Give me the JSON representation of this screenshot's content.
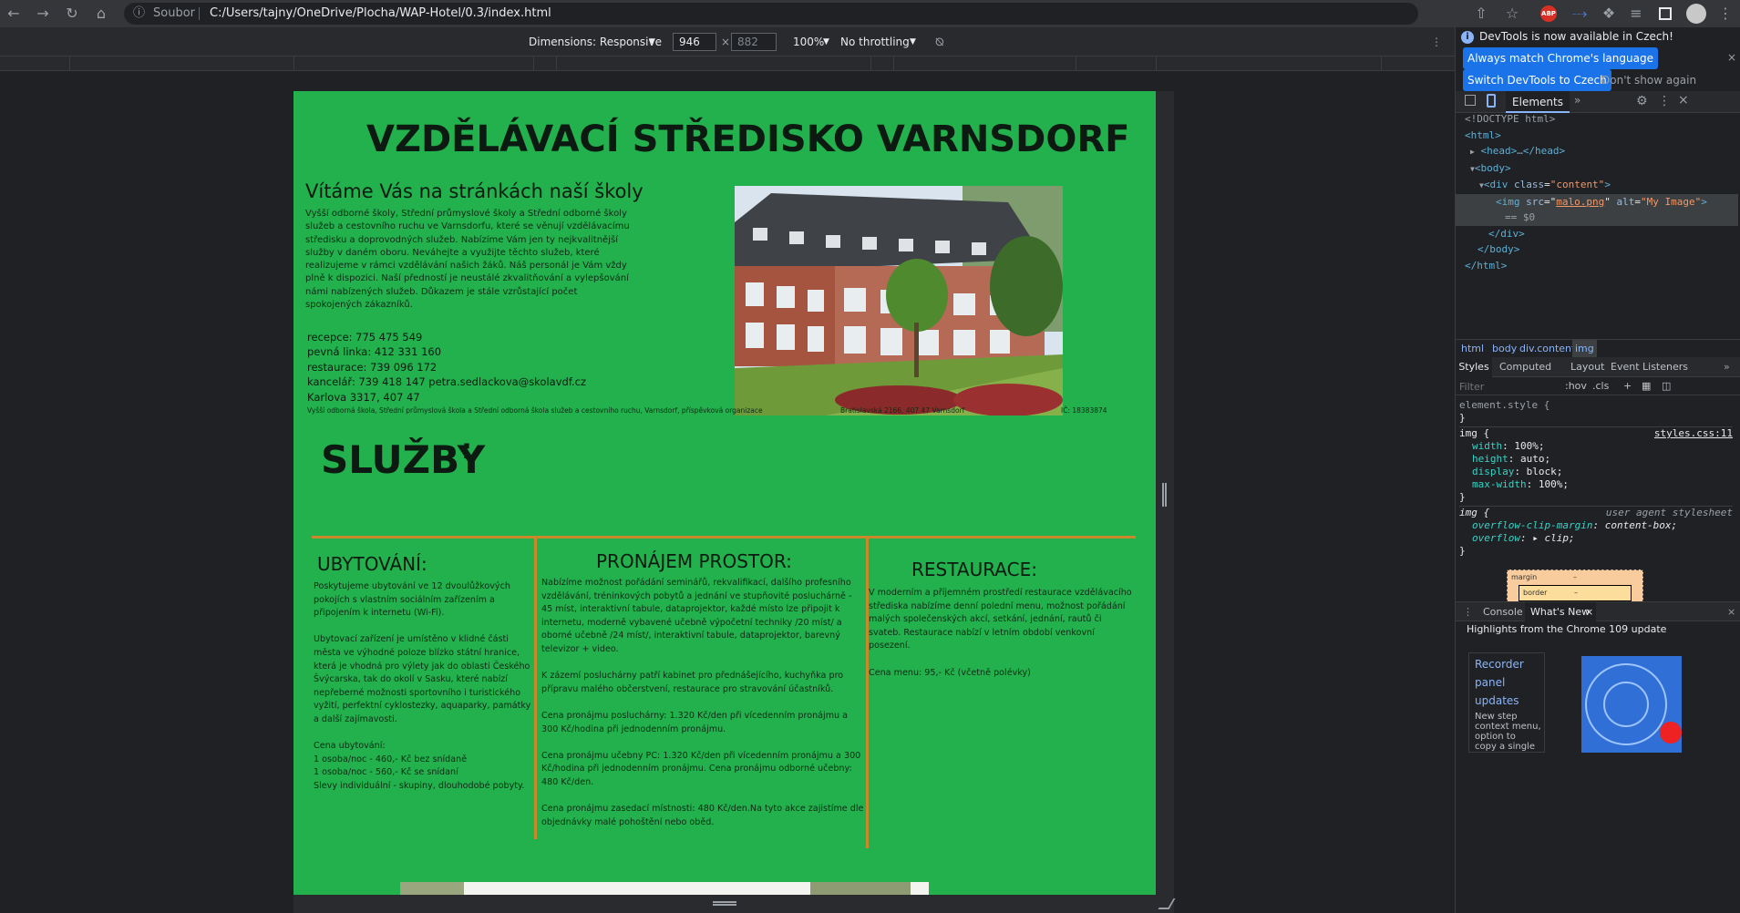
{
  "browser": {
    "url_security": "Soubor",
    "url": "C:/Users/tajny/OneDrive/Plocha/WAP-Hotel/0.3/index.html",
    "ext_abp": "ABP"
  },
  "device_toolbar": {
    "dimensions_label": "Dimensions: Responsive",
    "width": "946",
    "height": "882",
    "zoom": "100%",
    "throttling": "No throttling"
  },
  "page": {
    "title": "VZDĚLÁVACÍ STŘEDISKO VARNSDORF",
    "welcome": "Vítáme Vás na stránkách naší školy",
    "intro_lines": [
      "Vyšší odborné školy, Střední průmyslové školy a Střední odborné školy",
      "služeb a cestovního ruchu ve Varnsdorfu, které se věnují vzdělávacímu",
      "středisku a doprovodných služeb. Nabízíme Vám jen ty nejkvalitnější",
      "služby v daném oboru. Neváhejte a využijte těchto služeb, které",
      "realizujeme v rámci vzdělávání našich žáků. Náš personál je Vám vždy",
      "plně k dispozici. Naší předností je neustálé zkvalitňování a vylepšování",
      "námi nabízených služeb. Důkazem je stále vzrůstající počet",
      "spokojených zákazníků."
    ],
    "contact_lines": [
      "recepce: 775 475 549",
      "pevná linka: 412 331 160",
      "restaurace: 739 096 172",
      "kancelář: 739 418 147 petra.sedlackova@skolavdf.cz",
      "Karlova 3317, 407 47"
    ],
    "footer_org": "Vyšší odborná škola, Střední průmyslová škola a Střední odborná škola služeb a cestovního ruchu, Varnsdorf, příspěvková organizace",
    "footer_address": "Bratislavská 2166, 407 47 Varnsdorf",
    "footer_ic": "IČ: 18383874",
    "services_heading": "SLUŽBY",
    "services_colon": ":",
    "col1_title": "UBYTOVÁNÍ:",
    "col1_text": "Poskytujeme ubytování ve 12 dvoulůžkových\npokojích s vlastním sociálním zařízením a\npřipojením k internetu (Wi-Fi).\n\nUbytovací zařízení je umístěno v klidné části\nměsta ve výhodné poloze blízko státní hranice,\nkterá je vhodná pro výlety jak do oblasti Českého\nŠvýcarska, tak do okolí v Sasku, které nabízí\nnepřeberné možnosti sportovního i turistického\nvyžití, perfektní cyklostezky, aquaparky, památky\na další zajímavosti.\n\nCena ubytování:\n1 osoba/noc - 460,- Kč bez snídaně\n1 osoba/noc - 560,- Kč se snídaní\nSlevy individuální - skupiny, dlouhodobé pobyty.",
    "col2_title": "PRONÁJEM PROSTOR:",
    "col2_text": "Nabízíme možnost pořádání seminářů, rekvalifikací, dalšího profesního\nvzdělávání, tréninkových pobytů a jednání ve stupňovité posluchárně -\n45 míst, interaktivní tabule, dataprojektor, každé místo lze připojit k\ninternetu, moderně vybavené učebně výpočetní techniky /20 míst/ a\noborné učebně /24 míst/, interaktivní tabule, dataprojektor, barevný\ntelevizor + video.\n\nK zázemí posluchárny patří kabinet pro přednášejícího, kuchyňka pro\npřípravu malého občerstvení, restaurace pro stravování účastníků.\n\nCena pronájmu posluchárny: 1.320 Kč/den při vícedenním pronájmu a\n300 Kč/hodina při jednodenním pronájmu.\n\nCena pronájmu učebny PC: 1.320 Kč/den při vícedenním pronájmu a 300\nKč/hodina při jednodenním pronájmu. Cena pronájmu odborné učebny:\n480 Kč/den.\n\nCena pronájmu zasedací místnosti: 480 Kč/den.Na tyto akce zajistíme dle\nobjednávky malé pohoštění nebo oběd.",
    "col3_title": "RESTAURACE:",
    "col3_text": "V moderním a příjemném prostředí restaurace vzdělávacího\nstřediska nabízíme denní polední menu, možnost pořádání\nmalých společenských akcí, setkání, jednání, rautů či\nsvateb. Restaurace nabízí v letním období venkovní\nposezení.\n\nCena menu: 95,- Kč (včetně polévky)"
  },
  "devtools": {
    "banner": "DevTools is now available in Czech!",
    "btn_match": "Always match Chrome's language",
    "btn_switch": "Switch DevTools to Czech",
    "btn_dont": "Don't show again",
    "tab_elements": "Elements",
    "dom": {
      "doctype": "<!DOCTYPE html>",
      "html_open": "<html>",
      "head": "<head>…</head>",
      "body_open": "<body>",
      "div_open_tag": "<div ",
      "div_class_attr": "class",
      "div_class_val": "\"content\"",
      "img_tag": "<img ",
      "img_src_attr": "src",
      "img_src_val": "malo.png",
      "img_alt_attr": "alt",
      "img_alt_val": "\"My Image\"",
      "dollar": "== $0",
      "div_close": "</div>",
      "body_close": "</body>",
      "html_close": "</html>"
    },
    "breadcrumbs": [
      "html",
      "body",
      "div.content",
      "img"
    ],
    "style_tabs": [
      "Styles",
      "Computed",
      "Layout",
      "Event Listeners"
    ],
    "filter_placeholder": "Filter",
    "hov": ":hov",
    "cls": ".cls",
    "rule1_selector": "element.style {",
    "rule_close": "}",
    "rule2_selector": "img {",
    "rule2_source": "styles.css:11",
    "rule2_props": [
      {
        "name": "width",
        "value": "100%;"
      },
      {
        "name": "height",
        "value": "auto;"
      },
      {
        "name": "display",
        "value": "block;"
      },
      {
        "name": "max-width",
        "value": "100%;"
      }
    ],
    "rule3_selector": "img {",
    "rule3_source": "user agent stylesheet",
    "rule3_props": [
      {
        "name": "overflow-clip-margin",
        "value": "content-box;"
      },
      {
        "name": "overflow",
        "value": "▸ clip;"
      }
    ],
    "box_margin": "margin",
    "box_border": "border",
    "box_dash": "–",
    "drawer_console": "Console",
    "drawer_whatsnew": "What's New",
    "whatsnew_title": "Highlights from the Chrome 109 update",
    "recorder_title_lines": [
      "Recorder",
      "panel",
      "updates"
    ],
    "recorder_desc_lines": [
      "New step",
      "context menu,",
      "option to",
      "copy a single"
    ]
  }
}
